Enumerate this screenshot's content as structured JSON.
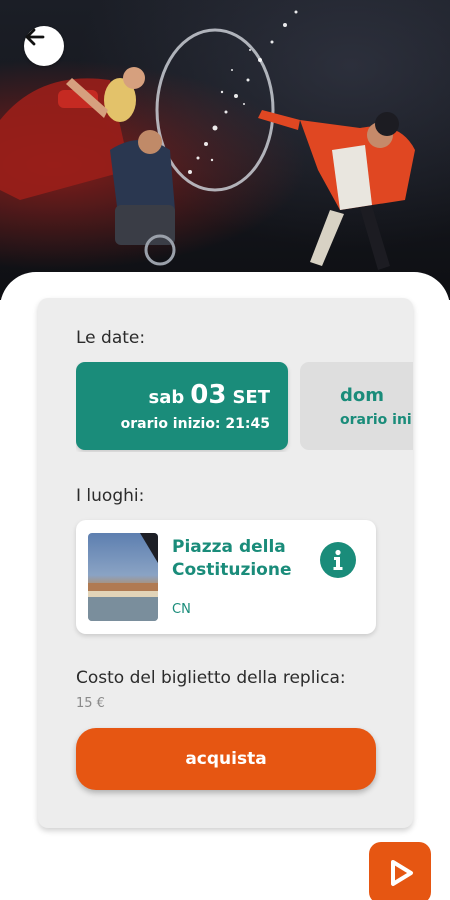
{
  "hero": {
    "image": "circus-performers-photo"
  },
  "nav": {
    "back_icon": "arrow-left-icon"
  },
  "dates": {
    "label": "Le date:",
    "items": [
      {
        "dow": "sab",
        "day": "03",
        "month": "SET",
        "time_label": "orario inizio:",
        "time": "21:45",
        "selected": true
      },
      {
        "dow": "dom",
        "day": "",
        "month": "",
        "time_label": "orario ini",
        "time": "",
        "selected": false
      }
    ]
  },
  "venues": {
    "label": "I luoghi:",
    "items": [
      {
        "name": "Piazza della Costituzione",
        "province": "CN",
        "info_icon": "info-icon"
      }
    ]
  },
  "cost": {
    "label": "Costo del biglietto della replica:",
    "value": "15 €"
  },
  "buy_button": {
    "label": "acquista"
  },
  "fab": {
    "icon": "play-icon"
  },
  "colors": {
    "teal": "#1a8c7a",
    "orange": "#e65612",
    "card_bg": "#ededed"
  }
}
